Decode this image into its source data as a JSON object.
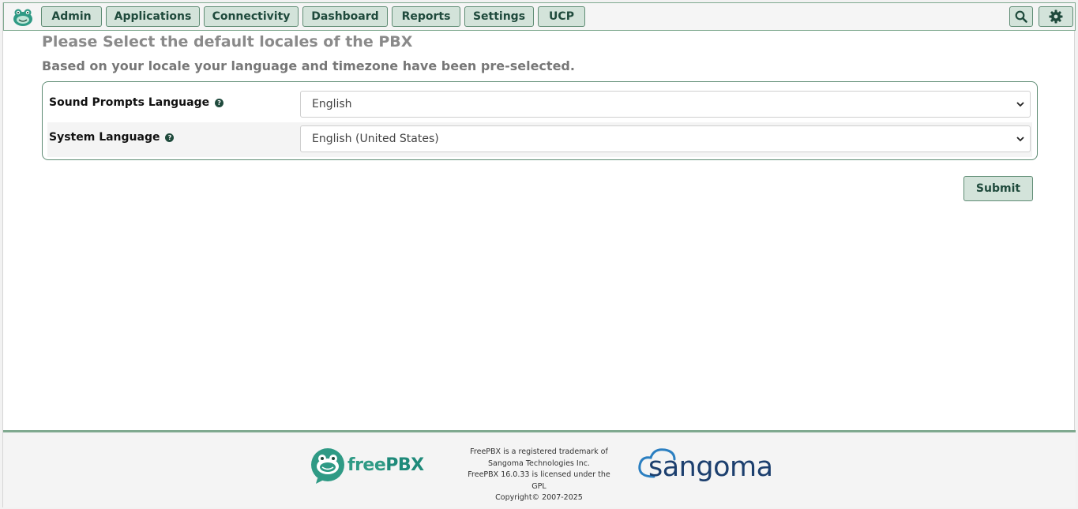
{
  "nav": {
    "items": [
      {
        "label": "Admin"
      },
      {
        "label": "Applications"
      },
      {
        "label": "Connectivity"
      },
      {
        "label": "Dashboard"
      },
      {
        "label": "Reports"
      },
      {
        "label": "Settings"
      },
      {
        "label": "UCP"
      }
    ],
    "search_icon": "search-icon",
    "settings_icon": "gear-icon"
  },
  "page": {
    "title": "Please Select the default locales of the PBX",
    "subtitle": "Based on your locale your language and timezone have been pre-selected."
  },
  "form": {
    "sound_prompts": {
      "label": "Sound Prompts Language",
      "value": "English"
    },
    "system_language": {
      "label": "System Language",
      "value": "English (United States)"
    },
    "help_glyph": "?",
    "submit_label": "Submit"
  },
  "footer": {
    "brand_free": "free",
    "brand_pbx": "PBX",
    "legal": [
      "FreePBX is a registered trademark of",
      "Sangoma Technologies Inc.",
      "FreePBX 16.0.33 is licensed under the",
      "GPL",
      "Copyright© 2007-2025"
    ],
    "sangoma_logo_text": "Sangoma"
  },
  "colors": {
    "accent": "#1f4a3c",
    "button_bg": "#d3e3da",
    "border_green": "#5f8c74",
    "freepbx_teal": "#2f9a85",
    "sangoma_blue": "#1c3f6e",
    "sangoma_cloud": "#2b7fc1"
  }
}
